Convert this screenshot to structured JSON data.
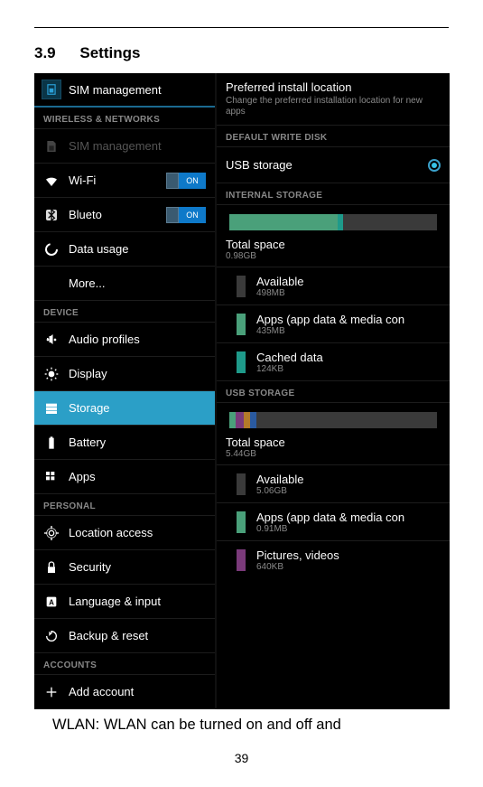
{
  "heading_num": "3.9",
  "heading_text": "Settings",
  "titlebar": "SIM management",
  "sections_left": {
    "wireless": "WIRELESS & NETWORKS",
    "device": "DEVICE",
    "personal": "PERSONAL",
    "accounts": "ACCOUNTS"
  },
  "left_items": {
    "sim_mgmt": "SIM management",
    "wifi": "Wi-Fi",
    "bluetooth": "Blueto",
    "data_usage": "Data usage",
    "more": "More...",
    "audio": "Audio profiles",
    "display": "Display",
    "storage": "Storage",
    "battery": "Battery",
    "apps": "Apps",
    "location": "Location access",
    "security": "Security",
    "lang": "Language & input",
    "backup": "Backup & reset",
    "add_account": "Add account"
  },
  "toggle_on": "ON",
  "right": {
    "pref_title": "Preferred install location",
    "pref_sub": "Change the preferred installation location for new apps",
    "default_disk": "DEFAULT WRITE DISK",
    "usb_storage": "USB storage",
    "internal": "INTERNAL STORAGE",
    "total": "Total space",
    "total_internal": "0.98GB",
    "available": "Available",
    "available_internal": "498MB",
    "apps_data": "Apps (app data & media con",
    "apps_data_internal": "435MB",
    "cached": "Cached data",
    "cached_internal": "124KB",
    "usb_section": "USB STORAGE",
    "total_usb": "5.44GB",
    "available_usb": "5.06GB",
    "apps_data_usb": "0.91MB",
    "pics": "Pictures, videos",
    "pics_usb": "640KB"
  },
  "body_text": "WLAN: WLAN can be turned on and off and",
  "page_num": "39"
}
